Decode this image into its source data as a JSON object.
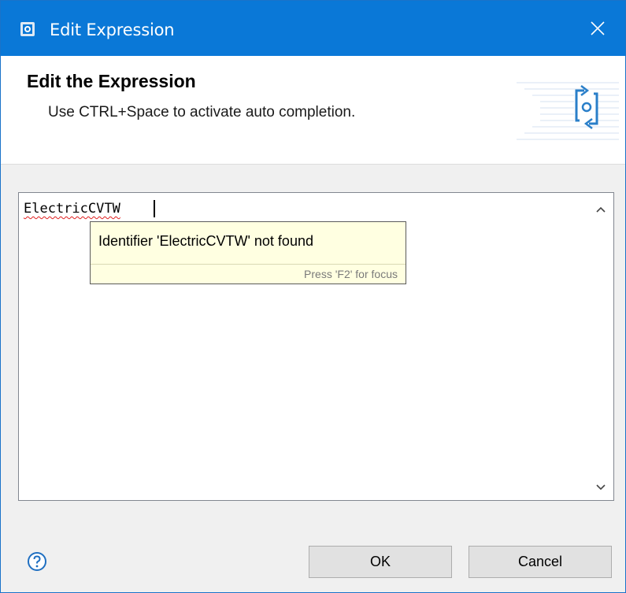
{
  "window": {
    "title": "Edit Expression",
    "title_icon": "app-logo-icon",
    "close_icon": "close-icon"
  },
  "banner": {
    "title": "Edit the Expression",
    "description": "Use CTRL+Space to activate auto completion.",
    "art_icon": "expression-banner-icon"
  },
  "editor": {
    "value": "ElectricCVTW",
    "scroll_up_icon": "chevron-up-icon",
    "scroll_down_icon": "chevron-down-icon"
  },
  "tooltip": {
    "message": "Identifier 'ElectricCVTW' not found",
    "hint": "Press 'F2' for focus"
  },
  "footer": {
    "help_icon": "help-icon",
    "ok_label": "OK",
    "cancel_label": "Cancel"
  },
  "colors": {
    "titlebar": "#0a78d7",
    "tooltip_bg": "#ffffe1",
    "error_underline": "#e02020",
    "button_bg": "#e1e1e1"
  }
}
